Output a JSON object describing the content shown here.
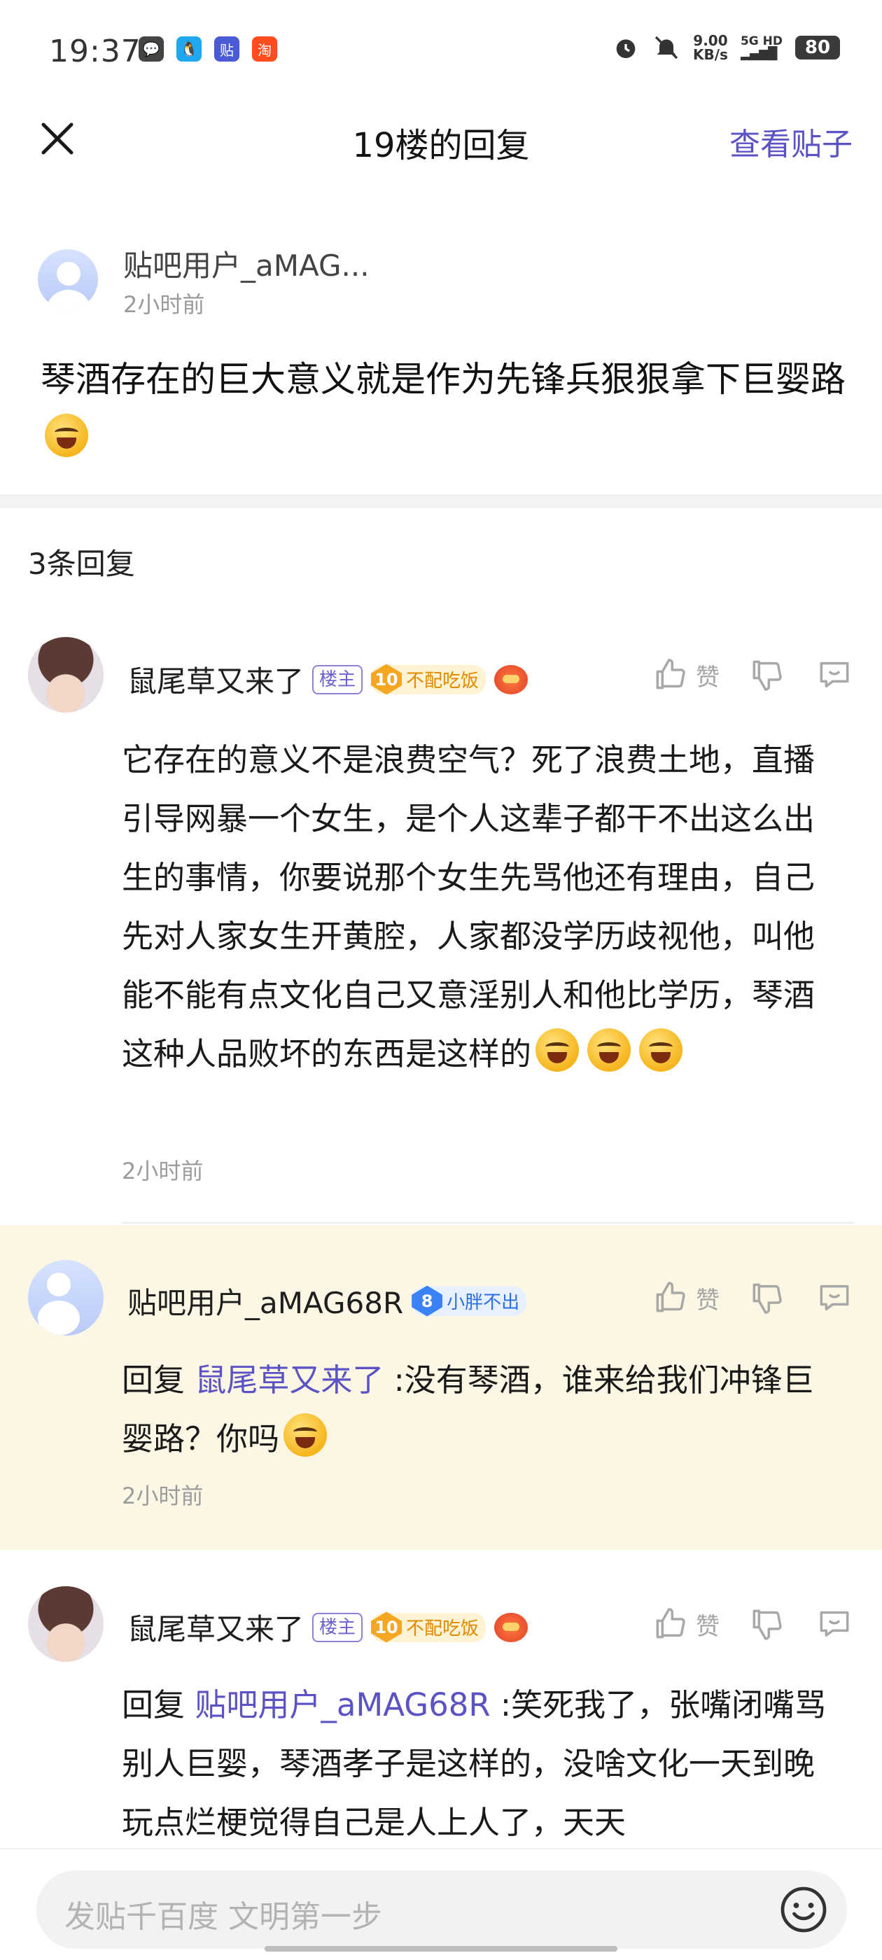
{
  "status_bar": {
    "time": "19:37",
    "net_speed_value": "9.00",
    "net_speed_unit": "KB/s",
    "signal": "5G HD",
    "battery": "80",
    "icons": [
      "wechat-icon",
      "qq-icon",
      "tieba-icon",
      "taobao-icon",
      "alarm-icon",
      "mute-icon"
    ]
  },
  "header": {
    "title": "19楼的回复",
    "right_link": "查看贴子"
  },
  "main_post": {
    "user_name": "贴吧用户_aMAG...",
    "time": "2小时前",
    "text": "琴酒存在的巨大意义就是作为先锋兵狠狠拿下巨婴路"
  },
  "reply_count": "3条回复",
  "comments": [
    {
      "user_name": "鼠尾草又来了",
      "owner_tag": "楼主",
      "level": "10",
      "level_title": "不配吃饭",
      "like_label": "赞",
      "text": "它存在的意义不是浪费空气？死了浪费土地，直播引导网暴一个女生，是个人这辈子都干不出这么出生的事情，你要说那个女生先骂他还有理由，自己先对人家女生开黄腔，人家都没学历歧视他，叫他能不能有点文化自己又意淫别人和他比学历，琴酒这种人品败坏的东西是这样的",
      "time": "2小时前"
    },
    {
      "user_name": "贴吧用户_aMAG68R",
      "level": "8",
      "level_title": "小胖不出",
      "like_label": "赞",
      "reply_prefix": "回复 ",
      "reply_to": "鼠尾草又来了",
      "text": " :没有琴酒，谁来给我们冲锋巨婴路？你吗",
      "time": "2小时前"
    },
    {
      "user_name": "鼠尾草又来了",
      "owner_tag": "楼主",
      "level": "10",
      "level_title": "不配吃饭",
      "like_label": "赞",
      "reply_prefix": "回复 ",
      "reply_to": "贴吧用户_aMAG68R",
      "text": " :笑死我了，张嘴闭嘴骂别人巨婴，琴酒孝子是这样的，没啥文化一天到晚玩点烂梗觉得自己是人上人了，天天"
    }
  ],
  "bottom_bar": {
    "placeholder": "发贴千百度 文明第一步"
  },
  "colors": {
    "accent": "#5b53c4",
    "highlight_bg": "#fbf7e4",
    "level_orange": "#f5a623",
    "level_blue": "#3b82f6"
  }
}
